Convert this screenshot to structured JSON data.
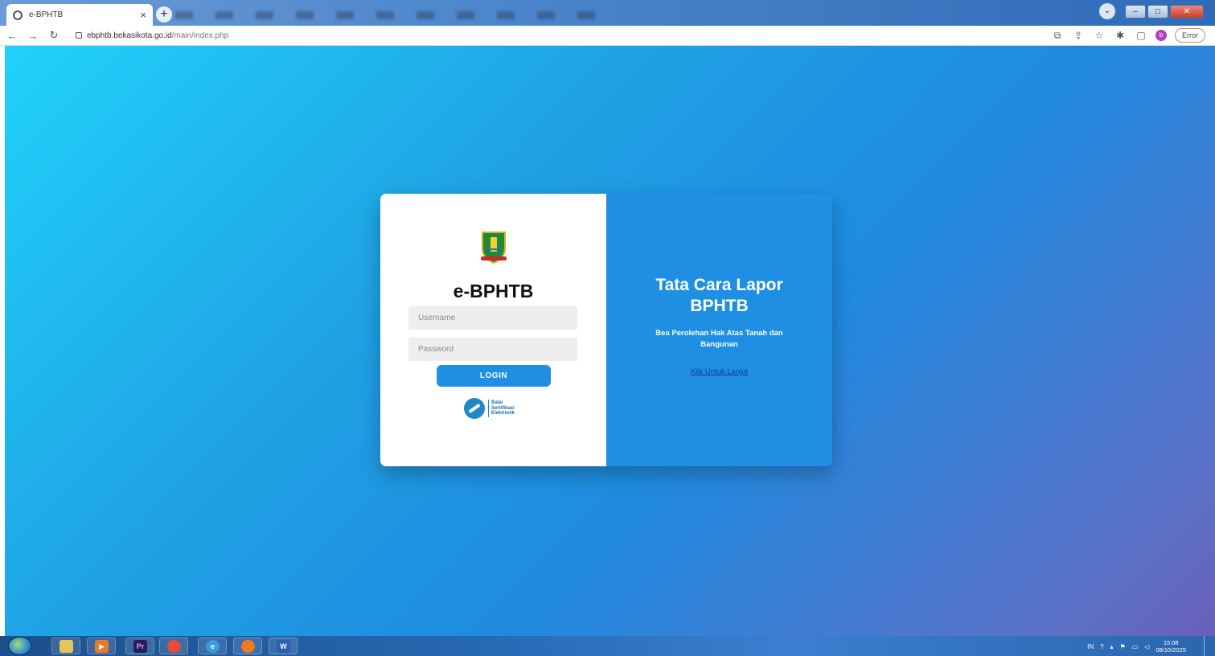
{
  "browser": {
    "tab_title": "e-BPHTB",
    "tab_close": "×",
    "new_tab": "+",
    "url_domain": "ebphtb.bekasikota.go.id",
    "url_path": "/main/index.php",
    "error_label": "Error"
  },
  "login": {
    "app_title": "e-BPHTB",
    "username_placeholder": "Username",
    "password_placeholder": "Password",
    "login_label": "LOGIN",
    "bsre_line1": "Balai",
    "bsre_line2": "Sertifikasi",
    "bsre_line3": "Elektronik"
  },
  "info": {
    "title_line1": "Tata Cara Lapor",
    "title_line2": "BPHTB",
    "subtitle": "Bea Perolehan Hak Atas Tanah dan Bangunan",
    "link_label": "Klik Untuk Lanjut"
  },
  "taskbar": {
    "language": "IN",
    "time": "15:08",
    "date": "08/10/2025"
  },
  "colors": {
    "accent": "#1f8fe3",
    "link": "#0f3a9c"
  }
}
